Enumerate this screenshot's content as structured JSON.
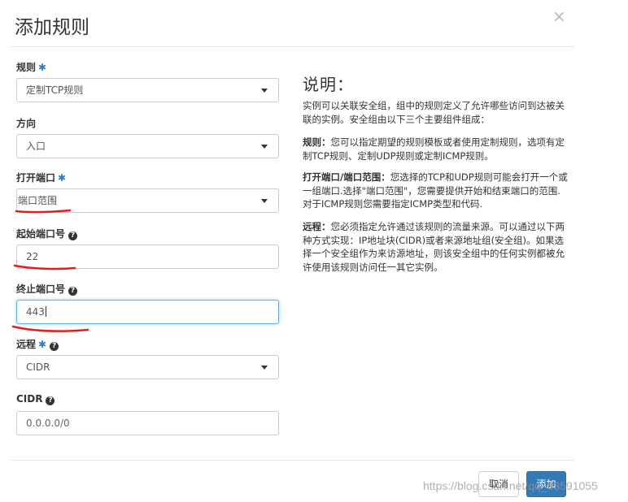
{
  "modal": {
    "title": "添加规则",
    "close_label": "×"
  },
  "form": {
    "rule": {
      "label": "规则",
      "value": "定制TCP规则"
    },
    "direction": {
      "label": "方向",
      "value": "入口"
    },
    "open_port": {
      "label": "打开端口",
      "value": "端口范围"
    },
    "from_port": {
      "label": "起始端口号",
      "value": "22"
    },
    "to_port": {
      "label": "终止端口号",
      "value": "443"
    },
    "remote": {
      "label": "远程",
      "value": "CIDR"
    },
    "cidr": {
      "label": "CIDR",
      "placeholder": "0.0.0.0/0"
    },
    "required_mark": "✱",
    "help_mark": "?"
  },
  "description": {
    "title": "说明：",
    "intro": "实例可以关联安全组，组中的规则定义了允许哪些访问到达被关联的实例。安全组由以下三个主要组件组成：",
    "rule_term": "规则：",
    "rule_text": "您可以指定期望的规则模板或者使用定制规则，选项有定制TCP规则、定制UDP规则或定制ICMP规则。",
    "port_term": "打开端口/端口范围：",
    "port_text": "您选择的TCP和UDP规则可能会打开一个或一组端口.选择\"端口范围\"，您需要提供开始和结束端口的范围.对于ICMP规则您需要指定ICMP类型和代码.",
    "remote_term": "远程：",
    "remote_text": "您必须指定允许通过该规则的流量来源。可以通过以下两种方式实现：IP地址块(CIDR)或者来源地址组(安全组)。如果选择一个安全组作为来访源地址，则该安全组中的任何实例都被允许使用该规则访问任一其它实例。"
  },
  "footer": {
    "cancel_label": "取消",
    "add_label": "添加"
  },
  "watermark": "https://blog.csdn.net/qq_33591055",
  "colors": {
    "accent": "#337ab7",
    "required": "#2d7ec8",
    "annotation_red": "#e0201b",
    "focus_border": "#66afe9"
  }
}
